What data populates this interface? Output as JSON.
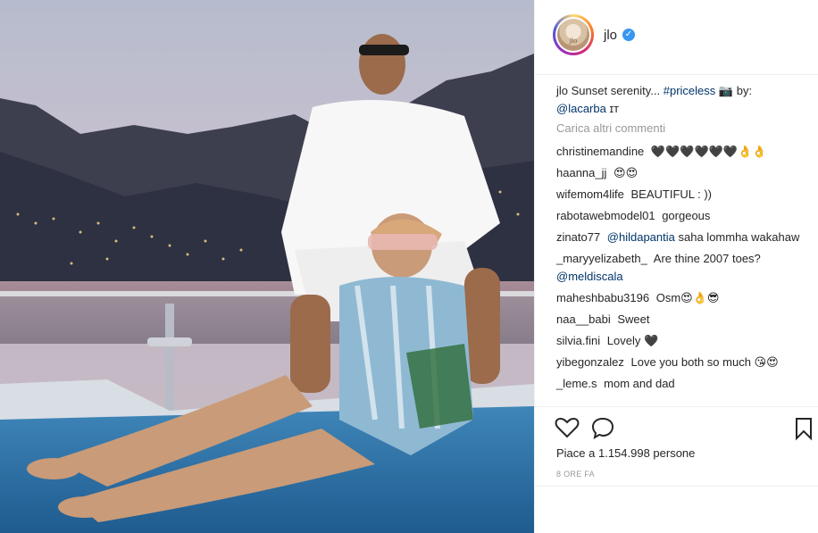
{
  "post": {
    "username": "jlo",
    "avatar_text": "jlo",
    "verified_icon": "verified-badge-icon",
    "caption": {
      "username": "jlo",
      "text": "Sunset serenity...",
      "hashtag": "#priceless",
      "camera_icon": "📷",
      "by": "by:",
      "credit": "@lacarba",
      "credit_suffix": "ɪᴛ"
    },
    "load_more": "Carica altri commenti",
    "comments": [
      {
        "user": "christinemandine",
        "text": "🖤🖤🖤🖤🖤🖤👌👌"
      },
      {
        "user": "haanna_jj",
        "text": "😍😍"
      },
      {
        "user": "wifemom4life",
        "text": "BEAUTIFUL : ))"
      },
      {
        "user": "rabotawebmodel01",
        "text": "gorgeous"
      },
      {
        "user": "zinato77",
        "mention": "@hildapantia",
        "text": "saha lommha wakahaw"
      },
      {
        "user": "_maryyelizabeth_",
        "text": "Are thine 2007 toes?",
        "mention2": "@meldiscala"
      },
      {
        "user": "maheshbabu3196",
        "text": "Osm😍👌😎"
      },
      {
        "user": "naa__babi",
        "text": "Sweet"
      },
      {
        "user": "silvia.fini",
        "text": "Lovely 🖤"
      },
      {
        "user": "yibegonzalez",
        "text": "Love you both so much 😘😍"
      },
      {
        "user": "_leme.s",
        "text": "mom and dad"
      }
    ],
    "likes": "Piace a 1.154.998 persone",
    "time": "8 ORE FA",
    "icons": {
      "like": "heart-icon",
      "comment": "comment-bubble-icon",
      "save": "bookmark-icon"
    }
  }
}
